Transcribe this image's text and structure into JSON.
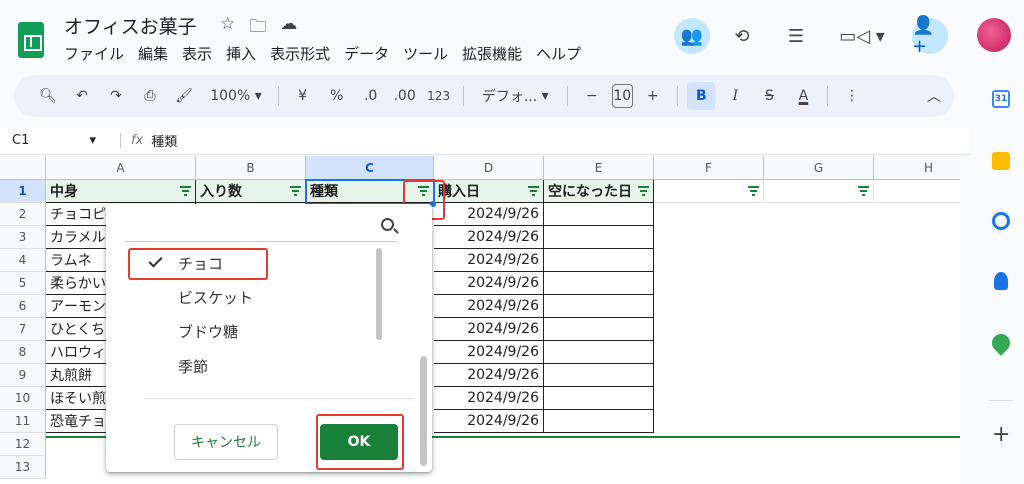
{
  "header": {
    "title": "オフィスお菓子",
    "menu": [
      "ファイル",
      "編集",
      "表示",
      "挿入",
      "表示形式",
      "データ",
      "ツール",
      "拡張機能",
      "ヘルプ"
    ]
  },
  "toolbar": {
    "zoom": "100%",
    "currency": "¥",
    "percent": "%",
    "dec_decrease": ".0",
    "dec_increase": ".00",
    "number_format": "123",
    "font": "デフォ...",
    "minus": "−",
    "font_size": "10",
    "plus": "+",
    "bold": "B",
    "italic": "I",
    "strike": "S",
    "text_color": "A"
  },
  "formula_bar": {
    "cell_ref": "C1",
    "fx": "fx",
    "content": "種類"
  },
  "columns": [
    "A",
    "B",
    "C",
    "D",
    "E",
    "F",
    "G",
    "H"
  ],
  "rows": [
    "1",
    "2",
    "3",
    "4",
    "5",
    "6",
    "7",
    "8",
    "9",
    "10",
    "11",
    "12",
    "13"
  ],
  "table_headers": [
    "中身",
    "入り数",
    "種類",
    "購入日",
    "空になった日"
  ],
  "col_a": [
    "チョコピ",
    "カラメル",
    "ラムネ",
    "柔らかい",
    "アーモン",
    "ひとくち",
    "ハロウィ",
    "丸煎餅",
    "ほそい煎",
    "恐竜チョ"
  ],
  "dates": [
    "2024/9/26",
    "2024/9/26",
    "2024/9/26",
    "2024/9/26",
    "2024/9/26",
    "2024/9/26",
    "2024/9/26",
    "2024/9/26",
    "2024/9/26",
    "2024/9/26"
  ],
  "dropdown": {
    "search_placeholder": "",
    "items": [
      "チョコ",
      "ビスケット",
      "ブドウ糖",
      "季節"
    ],
    "cancel": "キャンセル",
    "ok": "OK"
  },
  "colors": {
    "accent_green": "#188038",
    "header_fill": "#e6f4ea",
    "highlight_red": "#e53935",
    "selection_blue": "#1a73e8"
  }
}
